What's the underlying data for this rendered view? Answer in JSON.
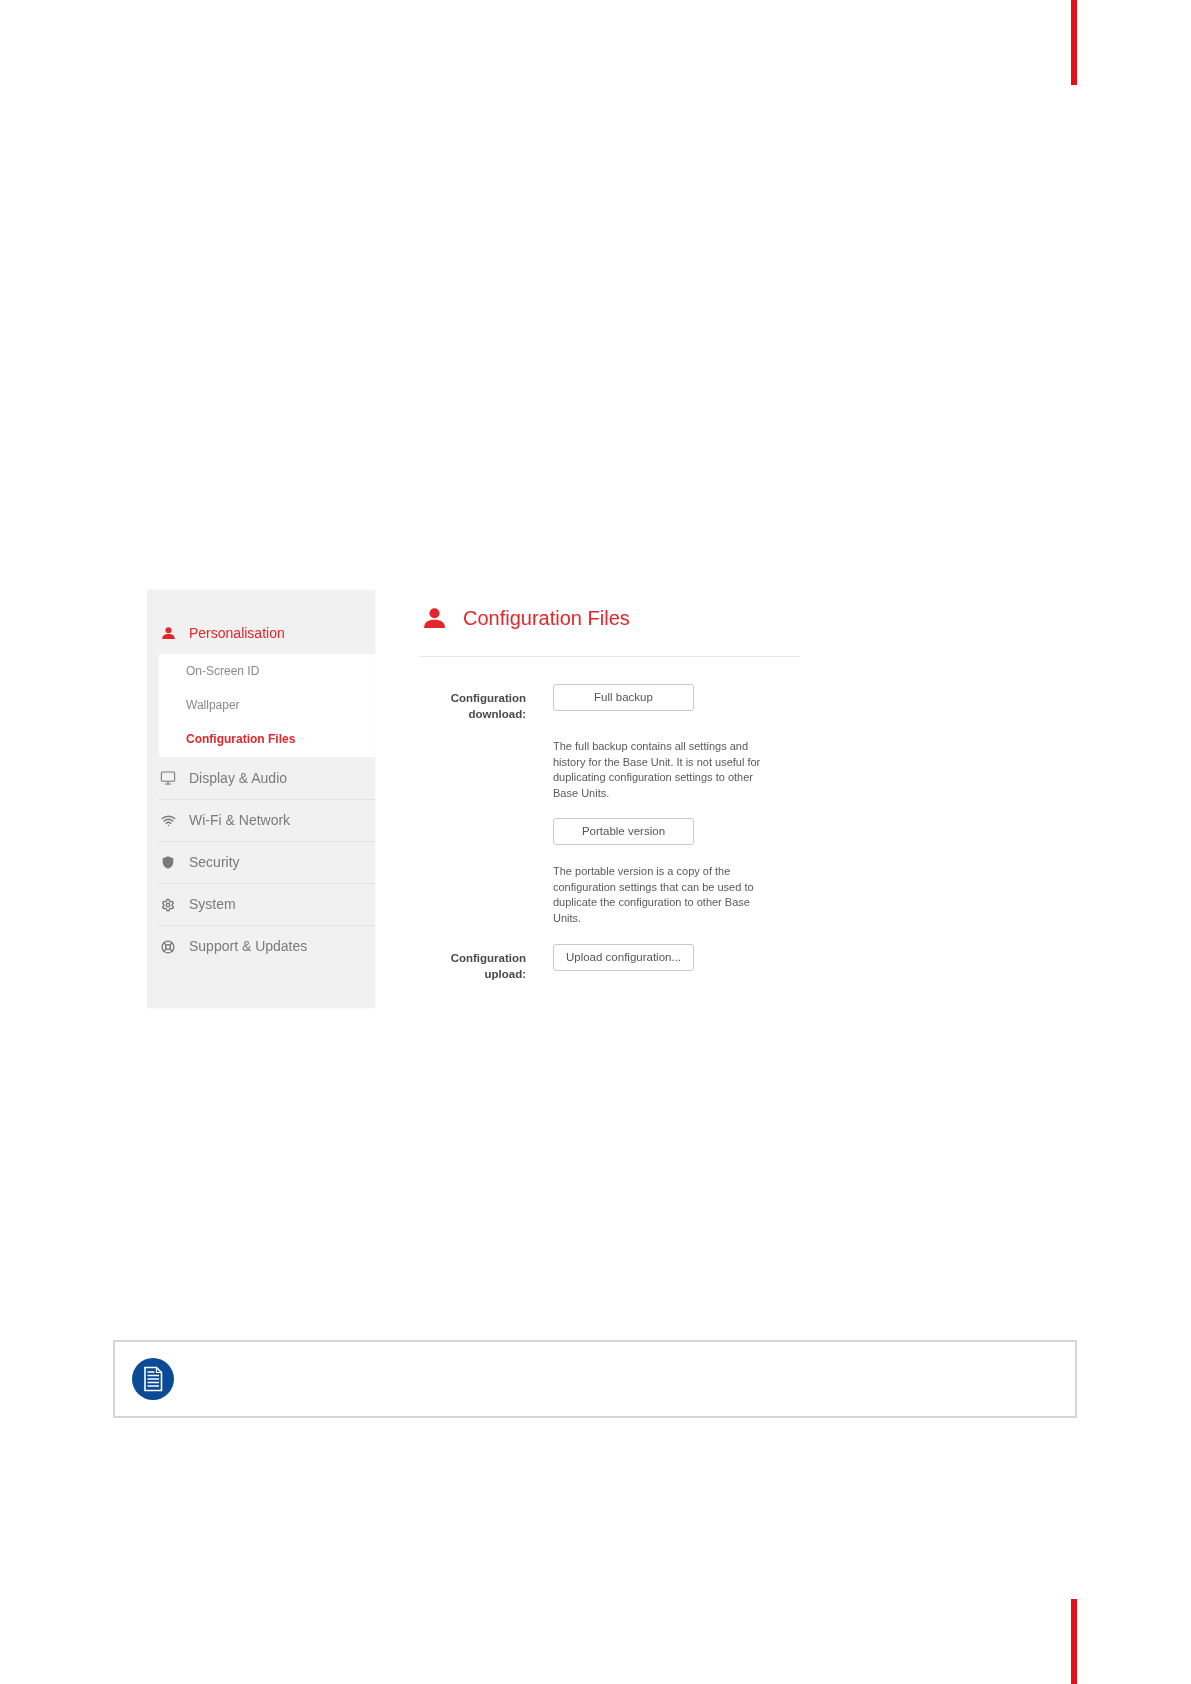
{
  "sidebar": {
    "items": [
      {
        "label": "Personalisation",
        "selected": true,
        "children": [
          {
            "label": "On-Screen ID",
            "selected": false
          },
          {
            "label": "Wallpaper",
            "selected": false
          },
          {
            "label": "Configuration Files",
            "selected": true
          }
        ]
      },
      {
        "label": "Display & Audio",
        "selected": false
      },
      {
        "label": "Wi-Fi & Network",
        "selected": false
      },
      {
        "label": "Security",
        "selected": false
      },
      {
        "label": "System",
        "selected": false
      },
      {
        "label": "Support & Updates",
        "selected": false
      }
    ]
  },
  "content": {
    "title": "Configuration Files",
    "fields": [
      {
        "label": "Configuration download:",
        "items": [
          {
            "kind": "button",
            "label": "Full backup"
          },
          {
            "kind": "note",
            "text": "The full backup contains all settings and history for the Base Unit. It is not useful for duplicating configuration settings to other Base Units."
          },
          {
            "kind": "button",
            "label": "Portable version"
          },
          {
            "kind": "note",
            "text": "The portable version is a copy of the configuration settings that can be used to duplicate the configuration to other Base Units."
          }
        ]
      },
      {
        "label": "Configuration upload:",
        "items": [
          {
            "kind": "button",
            "label": "Upload configuration..."
          }
        ]
      }
    ]
  }
}
